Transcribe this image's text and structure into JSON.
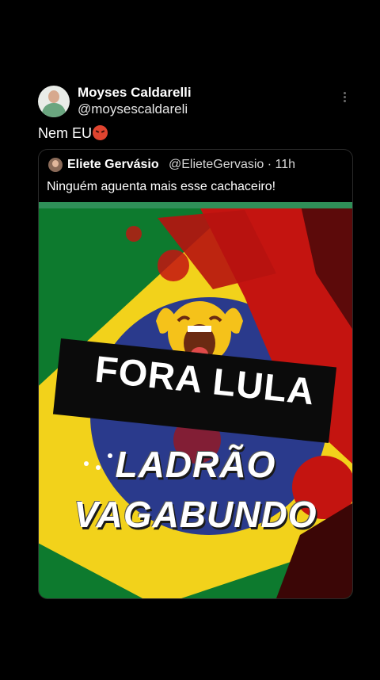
{
  "tweet": {
    "author_name": "Moyses Caldarelli",
    "author_handle": "@moysescaldareli",
    "text": "Nem EU",
    "text_emoji": "angry-face-emoji"
  },
  "quoted_tweet": {
    "author_name": "Eliete Gervásio",
    "meta": "@ElieteGervasio · 11h",
    "text": "Ninguém aguenta mais esse cachaceiro!",
    "image": {
      "banner_text": "FORA LULA",
      "line1": "LADRÃO",
      "line2": "VAGABUNDO",
      "emoji": "screaming-crying-face-emoji"
    }
  },
  "colors": {
    "background": "#000000",
    "flag_green": "#0d7a2e",
    "flag_yellow": "#f2d21b",
    "flag_blue": "#2a3a8c",
    "blood_red": "#c41410"
  }
}
